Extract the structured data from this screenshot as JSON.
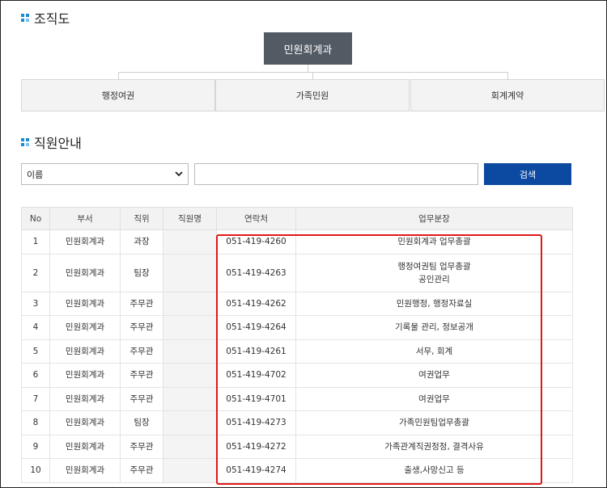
{
  "org": {
    "title": "조직도",
    "root": "민원회계과",
    "children": [
      "행정여권",
      "가족민원",
      "회계계약"
    ]
  },
  "staff": {
    "title": "직원안내",
    "select_value": "이름",
    "search_value": "",
    "search_button": "검색",
    "columns": [
      "No",
      "부서",
      "직위",
      "직원명",
      "연락처",
      "업무분장"
    ],
    "rows": [
      {
        "no": "1",
        "dept": "민원회계과",
        "pos": "과장",
        "name": "",
        "phone": "051-419-4260",
        "duty": "민원회계과 업무총괄"
      },
      {
        "no": "2",
        "dept": "민원회계과",
        "pos": "팀장",
        "name": "",
        "phone": "051-419-4263",
        "duty": "행정여권팀 업무총괄\n공인관리"
      },
      {
        "no": "3",
        "dept": "민원회계과",
        "pos": "주무관",
        "name": "",
        "phone": "051-419-4262",
        "duty": "민원행정, 행정자료실"
      },
      {
        "no": "4",
        "dept": "민원회계과",
        "pos": "주무관",
        "name": "",
        "phone": "051-419-4264",
        "duty": "기록물 관리, 정보공개"
      },
      {
        "no": "5",
        "dept": "민원회계과",
        "pos": "주무관",
        "name": "",
        "phone": "051-419-4261",
        "duty": "서무, 회계"
      },
      {
        "no": "6",
        "dept": "민원회계과",
        "pos": "주무관",
        "name": "",
        "phone": "051-419-4702",
        "duty": "여권업무"
      },
      {
        "no": "7",
        "dept": "민원회계과",
        "pos": "주무관",
        "name": "",
        "phone": "051-419-4701",
        "duty": "여권업무"
      },
      {
        "no": "8",
        "dept": "민원회계과",
        "pos": "팀장",
        "name": "",
        "phone": "051-419-4273",
        "duty": "가족민원팀업무총괄"
      },
      {
        "no": "9",
        "dept": "민원회계과",
        "pos": "주무관",
        "name": "",
        "phone": "051-419-4272",
        "duty": "가족관계직권정정, 결격사유"
      },
      {
        "no": "10",
        "dept": "민원회계과",
        "pos": "주무관",
        "name": "",
        "phone": "051-419-4274",
        "duty": "출생,사망신고 등"
      }
    ]
  },
  "colors": {
    "accent": "#0b4aa0",
    "highlight": "#e01818",
    "org_root": "#525a63"
  },
  "icons": [
    "section-bullet-icon",
    "chevron-down-icon"
  ]
}
